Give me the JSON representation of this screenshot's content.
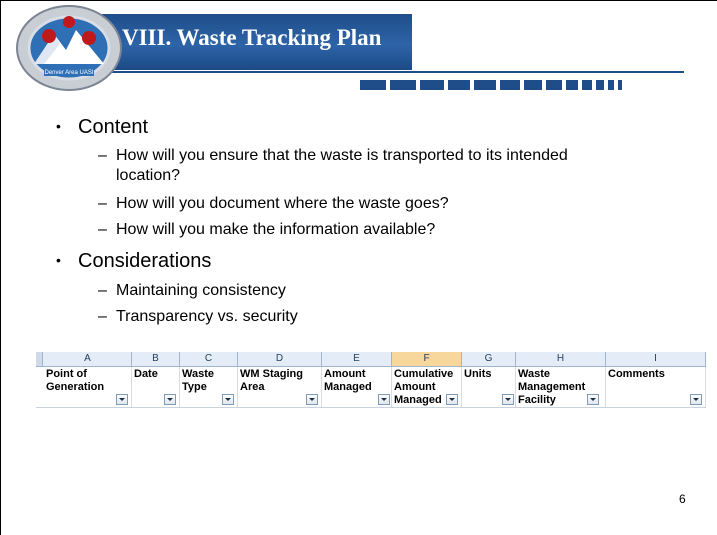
{
  "slide": {
    "title": "VIII. Waste Tracking Plan",
    "logo_text": "Denver Area UASI",
    "page_number": "6",
    "accent_color": "#1f4d8a"
  },
  "bullets": [
    {
      "label": "Content",
      "items": [
        [
          "How will you ensure that the waste is transported to its intended",
          "location?"
        ],
        [
          "How will you document where the waste goes?"
        ],
        [
          "How will you make the information available?"
        ]
      ]
    },
    {
      "label": "Considerations",
      "items": [
        [
          "Maintaining consistency"
        ],
        [
          "Transparency vs. security"
        ]
      ]
    }
  ],
  "spreadsheet": {
    "columns": [
      "A",
      "B",
      "C",
      "D",
      "E",
      "F",
      "G",
      "H",
      "I"
    ],
    "selected_column": "F",
    "headers": [
      "Point of\nGeneration",
      "Date",
      "Waste\nType",
      "WM Staging\nArea",
      "Amount\nManaged",
      "Cumulative\nAmount\nManaged",
      "Units",
      "Waste\nManagement\nFacility",
      "Comments"
    ]
  }
}
